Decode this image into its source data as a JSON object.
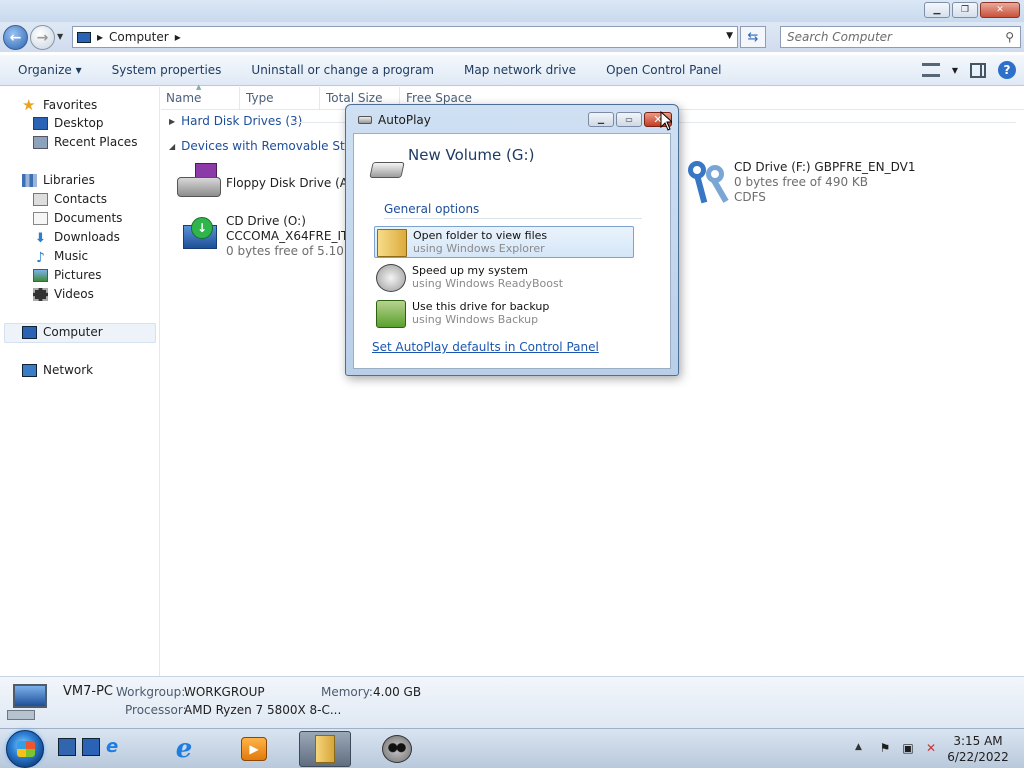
{
  "window": {
    "controls": {
      "minimize": "▁",
      "maximize": "❐",
      "close": "✕"
    }
  },
  "address": {
    "back_icon": "back-arrow-icon",
    "forward_icon": "forward-arrow-icon",
    "breadcrumb": "Computer",
    "breadcrumb_sep": "▸",
    "search_placeholder": "Search Computer"
  },
  "toolbar": {
    "items": [
      "Organize ▾",
      "System properties",
      "Uninstall or change a program",
      "Map network drive",
      "Open Control Panel"
    ],
    "help": "?"
  },
  "sidebar": {
    "favorites": "Favorites",
    "desktop": "Desktop",
    "recent_places": "Recent Places",
    "libraries": "Libraries",
    "contacts": "Contacts",
    "documents": "Documents",
    "downloads": "Downloads",
    "music": "Music",
    "pictures": "Pictures",
    "videos": "Videos",
    "computer": "Computer",
    "network": "Network"
  },
  "columns": [
    "Name",
    "Type",
    "Total Size",
    "Free Space"
  ],
  "groups": {
    "hard_disk": "Hard Disk Drives (3)",
    "removable": "Devices with Removable Storag"
  },
  "drives": {
    "floppy": {
      "name": "Floppy Disk Drive (A:)"
    },
    "cd_o": {
      "name": "CD Drive (O:)",
      "label": "CCCOMA_X64FRE_IT-I",
      "free": "0 bytes free of 5.10 GB"
    },
    "cd_f": {
      "name": "CD Drive (F:) GBPFRE_EN_DV1",
      "free": "0 bytes free of 490 KB",
      "fs": "CDFS"
    }
  },
  "details": {
    "pc_name": "VM7-PC",
    "workgroup_label": "Workgroup:",
    "workgroup": "WORKGROUP",
    "memory_label": "Memory:",
    "memory": "4.00 GB",
    "processor_label": "Processor:",
    "processor": "AMD Ryzen 7 5800X 8-C..."
  },
  "autoplay": {
    "title": "AutoPlay",
    "volume": "New Volume (G:)",
    "section": "General options",
    "options": [
      {
        "title": "Open folder to view files",
        "sub": "using Windows Explorer"
      },
      {
        "title": "Speed up my system",
        "sub": "using Windows ReadyBoost"
      },
      {
        "title": "Use this drive for backup",
        "sub": "using Windows Backup"
      }
    ],
    "link": "Set AutoPlay defaults in Control Panel",
    "controls": {
      "minimize": "▁",
      "maximize": "▭",
      "close": "✕"
    }
  },
  "taskbar": {
    "time": "3:15 AM",
    "date": "6/22/2022"
  }
}
